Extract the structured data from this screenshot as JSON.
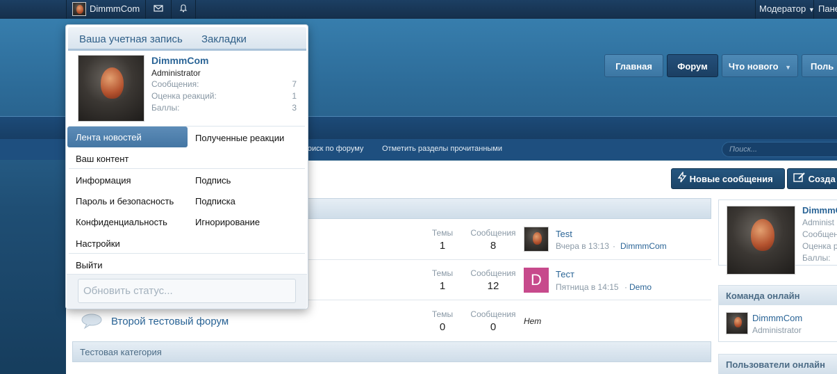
{
  "topbar": {
    "username": "DimmmCom",
    "moderator": "Модератор",
    "panel": "Пане"
  },
  "nav": {
    "home": "Главная",
    "forum": "Форум",
    "whats_new": "Что нового",
    "users": "Поль"
  },
  "subnav": {
    "search_forum": "Поиск по форуму",
    "mark_read": "Отметить разделы прочитанными",
    "search_placeholder": "Поиск..."
  },
  "actions": {
    "new_posts": "Новые сообщения",
    "create": "Созда"
  },
  "categories": [
    {
      "title": ""
    },
    {
      "title": "Тестовая категория"
    }
  ],
  "forums": [
    {
      "name": "",
      "threads_label": "Темы",
      "threads": "1",
      "posts_label": "Сообщения",
      "posts": "8",
      "last_title": "Test",
      "last_time": "Вчера в 13:13",
      "last_user": "DimmmCom",
      "avatar_letter": ""
    },
    {
      "name": "",
      "threads_label": "Темы",
      "threads": "1",
      "posts_label": "Сообщения",
      "posts": "12",
      "last_title": "Тест",
      "last_time": "Пятница в 14:15",
      "last_user": "Demo",
      "avatar_letter": "D"
    },
    {
      "name": "Второй тестовый форум",
      "threads_label": "Темы",
      "threads": "0",
      "posts_label": "Сообщения",
      "posts": "0",
      "last_none": "Нет"
    }
  ],
  "sidebar": {
    "user_name": "DimmmCom",
    "user_role": "Administ",
    "stat1": "Сообщен",
    "stat2": "Оценка р",
    "stat3": "Баллы:",
    "staff_title": "Команда онлайн",
    "staff_name": "DimmmCom",
    "staff_role": "Administrator",
    "users_title": "Пользователи онлайн"
  },
  "popup": {
    "tab_account": "Ваша учетная запись",
    "tab_bookmarks": "Закладки",
    "name": "DimmmCom",
    "role": "Administrator",
    "stats": [
      {
        "label": "Сообщения:",
        "value": "7"
      },
      {
        "label": "Оценка реакций:",
        "value": "1"
      },
      {
        "label": "Баллы:",
        "value": "3"
      }
    ],
    "menu": {
      "news_feed": "Лента новостей",
      "reactions": "Полученные реакции",
      "your_content": "Ваш контент",
      "info": "Информация",
      "signature": "Подпись",
      "password": "Пароль и безопасность",
      "subscription": "Подписка",
      "privacy": "Конфиденциальность",
      "ignoring": "Игнорирование",
      "settings": "Настройки",
      "logout": "Выйти"
    },
    "status_placeholder": "Обновить статус..."
  },
  "colors": {
    "accent": "#2a6496",
    "topbar": "#1c3f63",
    "nav_active": "#1f4a70"
  }
}
